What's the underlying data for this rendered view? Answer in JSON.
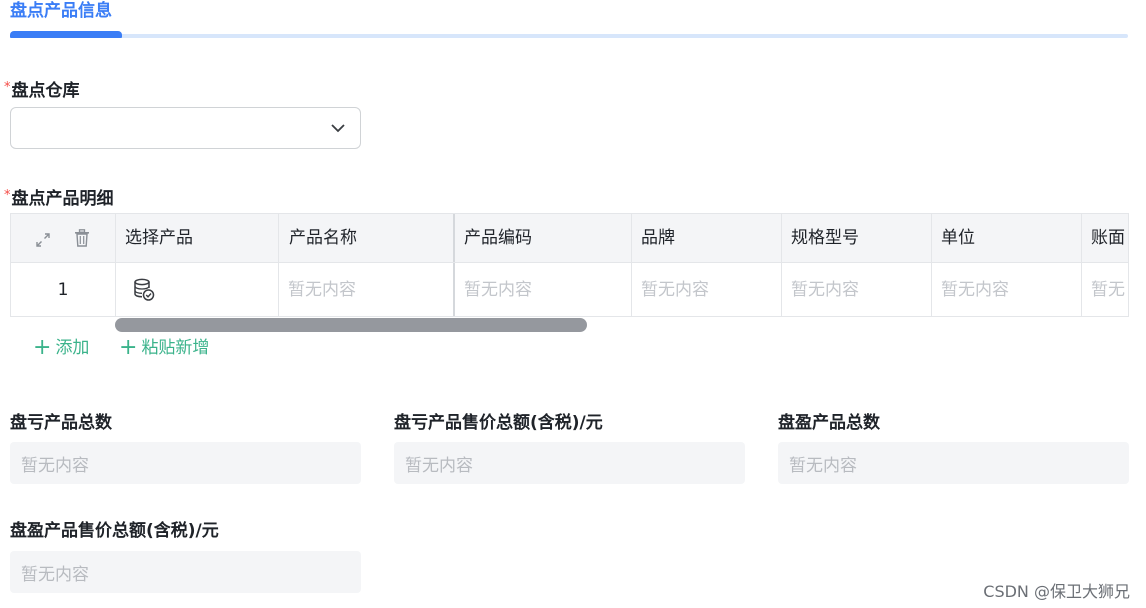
{
  "section": {
    "title": "盘点产品信息"
  },
  "warehouse": {
    "label": "盘点仓库",
    "required_mark": "*",
    "value": ""
  },
  "detail": {
    "label": "盘点产品明细",
    "required_mark": "*",
    "columns": [
      "选择产品",
      "产品名称",
      "产品编码",
      "品牌",
      "规格型号",
      "单位",
      "账面"
    ],
    "row": {
      "index": "1",
      "cells": [
        "暂无内容",
        "暂无内容",
        "暂无内容",
        "暂无内容",
        "暂无内容",
        "暂无"
      ]
    }
  },
  "actions": {
    "add": "添加",
    "paste_add": "粘贴新增",
    "plus": "+"
  },
  "summary": {
    "loss_count": {
      "label": "盘亏产品总数",
      "value": "暂无内容"
    },
    "loss_amount": {
      "label": "盘亏产品售价总额(含税)/元",
      "value": "暂无内容"
    },
    "gain_count": {
      "label": "盘盈产品总数",
      "value": "暂无内容"
    },
    "gain_amount": {
      "label": "盘盈产品售价总额(含税)/元",
      "value": "暂无内容"
    }
  },
  "watermark": "CSDN @保卫大狮兄",
  "colors": {
    "accent": "#3a7df6",
    "success": "#3bb38b",
    "required": "#f54a45"
  }
}
